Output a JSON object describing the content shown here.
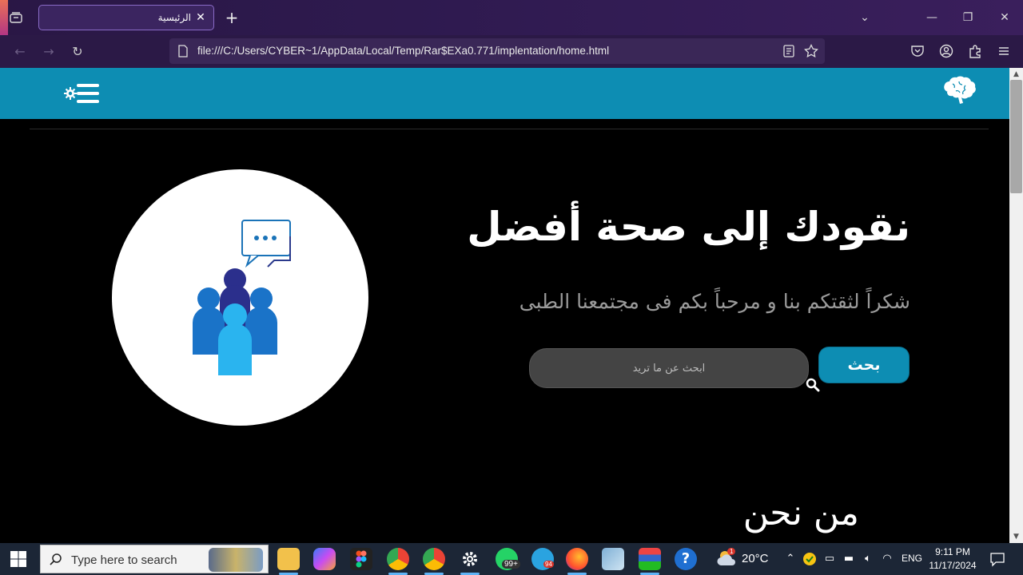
{
  "browser": {
    "tab_title": "الرئيسية",
    "url": "file:///C:/Users/CYBER~1/AppData/Local/Temp/Rar$EXa0.771/implentation/home.html",
    "accent": "#2b1946"
  },
  "site": {
    "header_color": "#0d8db3",
    "hero_title": "نقودك إلى صحة أفضل",
    "hero_subtitle": "شكراً لثقتكم بنا و مرحباً بكم فى مجتمعنا الطبى",
    "search_button": "بحث",
    "search_placeholder": "ابحث عن ما تريد",
    "about_heading": "من نحن"
  },
  "taskbar": {
    "search_placeholder": "Type here to search",
    "whatsapp_badge": "99+",
    "telegram_badge": "94",
    "weather_badge": "1",
    "temperature": "20°C",
    "language": "ENG",
    "time": "9:11 PM",
    "date": "11/17/2024"
  }
}
